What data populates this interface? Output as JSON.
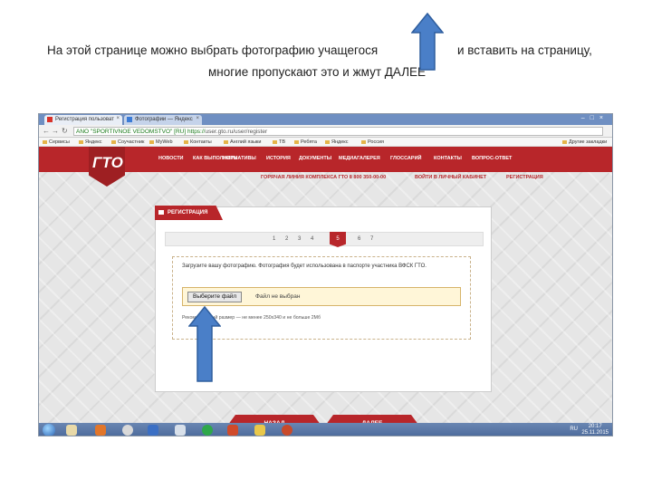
{
  "caption": {
    "line1_left": "На этой странице можно выбрать фотографию учащегося",
    "line1_right": "и вставить на страницу,",
    "line2": "многие пропускают это и жмут ДАЛЕЕ"
  },
  "browser": {
    "tabs": [
      "Регистрация пользоват",
      "Фотографии — Яндекс"
    ],
    "address_ev": "ANO \"SPORTIVNOE VEDOMSTVO\" [RU]",
    "address_scheme": "https://",
    "address_url": "user.gto.ru/user/register",
    "bookmarks": [
      "Сервисы",
      "Яндекс",
      "Соучастник",
      "MyWeb",
      "Контакты",
      "Англий языки",
      "ТВ",
      "Ребята",
      "Яндекс",
      "Россия",
      "Другие закладки"
    ]
  },
  "site": {
    "logo": "ГТО",
    "nav": [
      "НОВОСТИ",
      "КАК ВЫПОЛНИТЬ",
      "НОРМАТИВЫ",
      "ИСТОРИЯ",
      "ДОКУМЕНТЫ",
      "МЕДИАГАЛЕРЕЯ",
      "ГЛОССАРИЙ",
      "КОНТАКТЫ",
      "ВОПРОС-ОТВЕТ"
    ],
    "hotline": "ГОРЯЧАЯ ЛИНИЯ КОМПЛЕКСА ГТО 8 800 350-00-00",
    "cabinet": "ВОЙТИ В ЛИЧНЫЙ КАБИНЕТ",
    "register": "РЕГИСТРАЦИЯ"
  },
  "form": {
    "title": "РЕГИСТРАЦИЯ",
    "steps": [
      "1",
      "2",
      "3",
      "4",
      "5",
      "6",
      "7"
    ],
    "active_step": "5",
    "upload_text": "Загрузите вашу фотографию. Фотография будет использована в паспорте участника ВФСК ГТО.",
    "file_button": "Выберите файл",
    "no_file": "Файл не выбран",
    "requirements": "Рекомендуемый размер — не менее 250х340 и не больше 2Мб",
    "back_button": "НАЗАД",
    "next_button": "ДАЛЕЕ"
  },
  "taskbar": {
    "tray": "RU",
    "time": "20:17",
    "date": "25.11.2015"
  },
  "colors": {
    "brand_red": "#b8262a",
    "arrow_blue": "#4a7fc8"
  }
}
